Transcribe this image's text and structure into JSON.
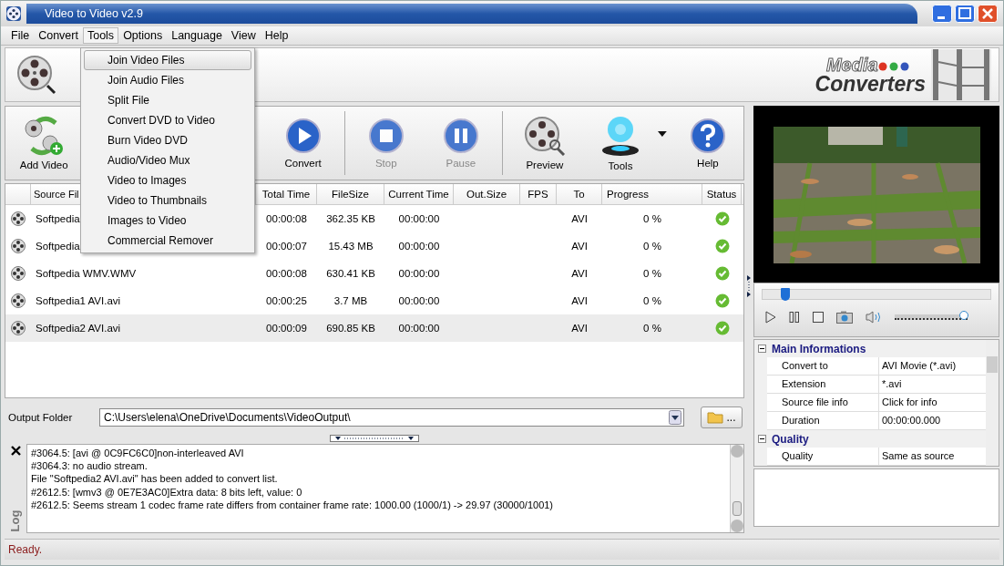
{
  "window": {
    "title": "Video to Video v2.9"
  },
  "menu_bar": [
    {
      "label": "File",
      "selected": false
    },
    {
      "label": "Convert",
      "selected": false
    },
    {
      "label": "Tools",
      "selected": true
    },
    {
      "label": "Options",
      "selected": false
    },
    {
      "label": "Language",
      "selected": false
    },
    {
      "label": "View",
      "selected": false
    },
    {
      "label": "Help",
      "selected": false
    }
  ],
  "tools_menu": [
    {
      "label": "Join Video Files",
      "selected": true
    },
    {
      "label": "Join Audio Files",
      "selected": false
    },
    {
      "label": "Split File",
      "selected": false
    },
    {
      "label": "Convert DVD to Video",
      "selected": false
    },
    {
      "label": "Burn Video DVD",
      "selected": false
    },
    {
      "label": "Audio/Video Mux",
      "selected": false
    },
    {
      "label": "Video to Images",
      "selected": false
    },
    {
      "label": "Video to Thumbnails",
      "selected": false
    },
    {
      "label": "Images to Video",
      "selected": false
    },
    {
      "label": "Commercial Remover",
      "selected": false
    }
  ],
  "banner": {
    "brand_top": "Media",
    "brand_bottom": "Converters"
  },
  "toolbar": [
    {
      "kind": "add",
      "label": "Add Video",
      "disabled": false
    },
    {
      "kind": "play",
      "label": "Convert",
      "disabled": false
    },
    {
      "kind": "stop",
      "label": "Stop",
      "disabled": true
    },
    {
      "kind": "pause",
      "label": "Pause",
      "disabled": true
    },
    {
      "kind": "preview",
      "label": "Preview",
      "disabled": false
    },
    {
      "kind": "tools",
      "label": "Tools",
      "disabled": false
    },
    {
      "kind": "help",
      "label": "Help",
      "disabled": false
    }
  ],
  "table": {
    "columns": [
      "Source Fil",
      "Total Time",
      "FileSize",
      "Current Time",
      "Out.Size",
      "FPS",
      "To",
      "Progress",
      "Status"
    ],
    "rows": [
      {
        "source": "Softpedia",
        "total_time": "00:00:08",
        "file_size": "362.35 KB",
        "current_time": "00:00:00",
        "to": "AVI",
        "progress": "0 %",
        "selected": false
      },
      {
        "source": "Softpedia",
        "total_time": "00:00:07",
        "file_size": "15.43 MB",
        "current_time": "00:00:00",
        "to": "AVI",
        "progress": "0 %",
        "selected": false
      },
      {
        "source": "Softpedia WMV.WMV",
        "total_time": "00:00:08",
        "file_size": "630.41 KB",
        "current_time": "00:00:00",
        "to": "AVI",
        "progress": "0 %",
        "selected": false
      },
      {
        "source": "Softpedia1 AVI.avi",
        "total_time": "00:00:25",
        "file_size": "3.7 MB",
        "current_time": "00:00:00",
        "to": "AVI",
        "progress": "0 %",
        "selected": false
      },
      {
        "source": "Softpedia2 AVI.avi",
        "total_time": "00:00:09",
        "file_size": "690.85 KB",
        "current_time": "00:00:00",
        "to": "AVI",
        "progress": "0 %",
        "selected": true
      }
    ]
  },
  "output_folder": {
    "label": "Output Folder",
    "value": "C:\\Users\\elena\\OneDrive\\Documents\\VideoOutput\\",
    "browse_label": "..."
  },
  "log": {
    "tab": "Log",
    "lines": [
      "#3064.5: [avi @ 0C9FC6C0]non-interleaved AVI",
      "#3064.3: no audio stream.",
      "File \"Softpedia2 AVI.avi\" has been added to convert list.",
      "#2612.5: [wmv3 @ 0E7E3AC0]Extra data: 8 bits left, value: 0",
      "#2612.5: Seems stream 1 codec frame rate differs from container frame rate: 1000.00 (1000/1) -> 29.97 (30000/1001)"
    ]
  },
  "player": {
    "seek": {
      "level": 0.1
    },
    "volume": {
      "level": 0.95
    }
  },
  "properties": [
    {
      "title": "Main Informations",
      "expanded": true,
      "rows": [
        {
          "name": "Convert to",
          "value": "AVI Movie (*.avi)"
        },
        {
          "name": "Extension",
          "value": "*.avi"
        },
        {
          "name": "Source file info",
          "value": "Click for info"
        },
        {
          "name": "Duration",
          "value": "00:00:00.000"
        }
      ]
    },
    {
      "title": "Quality",
      "expanded": true,
      "rows": [
        {
          "name": "Quality",
          "value": "Same as source"
        }
      ]
    }
  ],
  "status_bar": "Ready."
}
